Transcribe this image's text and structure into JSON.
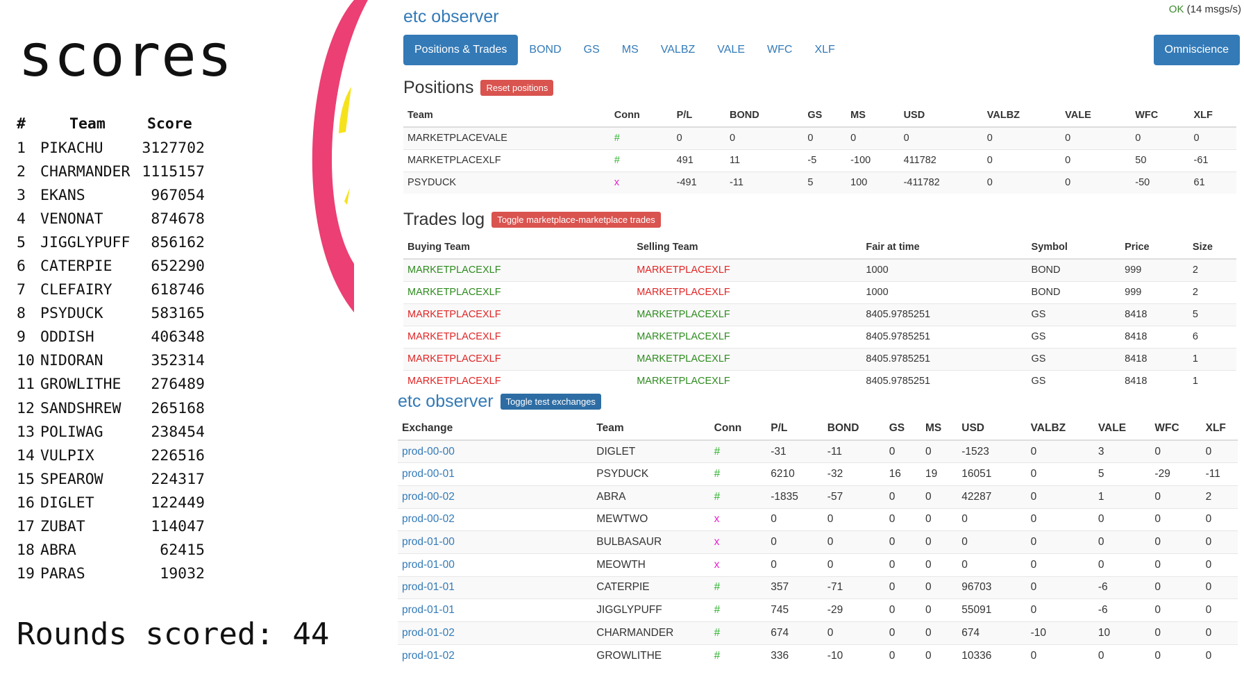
{
  "scoreboard": {
    "title": "scores",
    "headers": {
      "rank": "#",
      "team": "Team",
      "score": "Score"
    },
    "rows": [
      {
        "rank": "1",
        "team": "PIKACHU",
        "score": "3127702"
      },
      {
        "rank": "2",
        "team": "CHARMANDER",
        "score": "1115157"
      },
      {
        "rank": "3",
        "team": "EKANS",
        "score": "967054"
      },
      {
        "rank": "4",
        "team": "VENONAT",
        "score": "874678"
      },
      {
        "rank": "5",
        "team": "JIGGLYPUFF",
        "score": "856162"
      },
      {
        "rank": "6",
        "team": "CATERPIE",
        "score": "652290"
      },
      {
        "rank": "7",
        "team": "CLEFAIRY",
        "score": "618746"
      },
      {
        "rank": "8",
        "team": "PSYDUCK",
        "score": "583165"
      },
      {
        "rank": "9",
        "team": "ODDISH",
        "score": "406348"
      },
      {
        "rank": "10",
        "team": "NIDORAN",
        "score": "352314"
      },
      {
        "rank": "11",
        "team": "GROWLITHE",
        "score": "276489"
      },
      {
        "rank": "12",
        "team": "SANDSHREW",
        "score": "265168"
      },
      {
        "rank": "13",
        "team": "POLIWAG",
        "score": "238454"
      },
      {
        "rank": "14",
        "team": "VULPIX",
        "score": "226516"
      },
      {
        "rank": "15",
        "team": "SPEAROW",
        "score": "224317"
      },
      {
        "rank": "16",
        "team": "DIGLET",
        "score": "122449"
      },
      {
        "rank": "17",
        "team": "ZUBAT",
        "score": "114047"
      },
      {
        "rank": "18",
        "team": "ABRA",
        "score": "62415"
      },
      {
        "rank": "19",
        "team": "PARAS",
        "score": "19032"
      }
    ],
    "rounds_label": "Rounds scored: 44"
  },
  "observer1": {
    "brand": "etc observer",
    "status_ok": "OK",
    "status_rate": "(14 msgs/s)",
    "tabs": [
      "Positions & Trades",
      "BOND",
      "GS",
      "MS",
      "VALBZ",
      "VALE",
      "WFC",
      "XLF"
    ],
    "omniscience_label": "Omniscience",
    "positions": {
      "title": "Positions",
      "reset_label": "Reset positions",
      "headers": [
        "Team",
        "Conn",
        "P/L",
        "BOND",
        "GS",
        "MS",
        "USD",
        "VALBZ",
        "VALE",
        "WFC",
        "XLF"
      ],
      "rows": [
        {
          "team": "MARKETPLACEVALE",
          "conn": "#",
          "conn_ok": true,
          "cells": [
            "0",
            "0",
            "0",
            "0",
            "0",
            "0",
            "0",
            "0",
            "0"
          ]
        },
        {
          "team": "MARKETPLACEXLF",
          "conn": "#",
          "conn_ok": true,
          "cells": [
            "491",
            "11",
            "-5",
            "-100",
            "411782",
            "0",
            "0",
            "50",
            "-61"
          ]
        },
        {
          "team": "PSYDUCK",
          "conn": "x",
          "conn_ok": false,
          "cells": [
            "-491",
            "-11",
            "5",
            "100",
            "-411782",
            "0",
            "0",
            "-50",
            "61"
          ]
        }
      ]
    },
    "trades": {
      "title": "Trades log",
      "toggle_label": "Toggle marketplace-marketplace trades",
      "headers": [
        "Buying Team",
        "Selling Team",
        "Fair at time",
        "Symbol",
        "Price",
        "Size"
      ],
      "rows": [
        {
          "buy": "MARKETPLACEXLF",
          "buy_color": "green",
          "sell": "MARKETPLACEXLF",
          "sell_color": "red",
          "fair": "1000",
          "symbol": "BOND",
          "price": "999",
          "size": "2"
        },
        {
          "buy": "MARKETPLACEXLF",
          "buy_color": "green",
          "sell": "MARKETPLACEXLF",
          "sell_color": "red",
          "fair": "1000",
          "symbol": "BOND",
          "price": "999",
          "size": "2"
        },
        {
          "buy": "MARKETPLACEXLF",
          "buy_color": "red",
          "sell": "MARKETPLACEXLF",
          "sell_color": "green",
          "fair": "8405.9785251",
          "symbol": "GS",
          "price": "8418",
          "size": "5"
        },
        {
          "buy": "MARKETPLACEXLF",
          "buy_color": "red",
          "sell": "MARKETPLACEXLF",
          "sell_color": "green",
          "fair": "8405.9785251",
          "symbol": "GS",
          "price": "8418",
          "size": "6"
        },
        {
          "buy": "MARKETPLACEXLF",
          "buy_color": "red",
          "sell": "MARKETPLACEXLF",
          "sell_color": "green",
          "fair": "8405.9785251",
          "symbol": "GS",
          "price": "8418",
          "size": "1"
        },
        {
          "buy": "MARKETPLACEXLF",
          "buy_color": "red",
          "sell": "MARKETPLACEXLF",
          "sell_color": "green",
          "fair": "8405.9785251",
          "symbol": "GS",
          "price": "8418",
          "size": "1"
        }
      ]
    }
  },
  "observer2": {
    "brand": "etc observer",
    "toggle_label": "Toggle test exchanges",
    "headers": [
      "Exchange",
      "Team",
      "Conn",
      "P/L",
      "BOND",
      "GS",
      "MS",
      "USD",
      "VALBZ",
      "VALE",
      "WFC",
      "XLF"
    ],
    "rows": [
      {
        "exchange": "prod-00-00",
        "team": "DIGLET",
        "conn": "#",
        "conn_ok": true,
        "cells": [
          "-31",
          "-11",
          "0",
          "0",
          "-1523",
          "0",
          "3",
          "0",
          "0"
        ]
      },
      {
        "exchange": "prod-00-01",
        "team": "PSYDUCK",
        "conn": "#",
        "conn_ok": true,
        "cells": [
          "6210",
          "-32",
          "16",
          "19",
          "16051",
          "0",
          "5",
          "-29",
          "-11"
        ]
      },
      {
        "exchange": "prod-00-02",
        "team": "ABRA",
        "conn": "#",
        "conn_ok": true,
        "cells": [
          "-1835",
          "-57",
          "0",
          "0",
          "42287",
          "0",
          "1",
          "0",
          "2"
        ]
      },
      {
        "exchange": "prod-00-02",
        "team": "MEWTWO",
        "conn": "x",
        "conn_ok": false,
        "cells": [
          "0",
          "0",
          "0",
          "0",
          "0",
          "0",
          "0",
          "0",
          "0"
        ]
      },
      {
        "exchange": "prod-01-00",
        "team": "BULBASAUR",
        "conn": "x",
        "conn_ok": false,
        "cells": [
          "0",
          "0",
          "0",
          "0",
          "0",
          "0",
          "0",
          "0",
          "0"
        ]
      },
      {
        "exchange": "prod-01-00",
        "team": "MEOWTH",
        "conn": "x",
        "conn_ok": false,
        "cells": [
          "0",
          "0",
          "0",
          "0",
          "0",
          "0",
          "0",
          "0",
          "0"
        ]
      },
      {
        "exchange": "prod-01-01",
        "team": "CATERPIE",
        "conn": "#",
        "conn_ok": true,
        "cells": [
          "357",
          "-71",
          "0",
          "0",
          "96703",
          "0",
          "-6",
          "0",
          "0"
        ]
      },
      {
        "exchange": "prod-01-01",
        "team": "JIGGLYPUFF",
        "conn": "#",
        "conn_ok": true,
        "cells": [
          "745",
          "-29",
          "0",
          "0",
          "55091",
          "0",
          "-6",
          "0",
          "0"
        ]
      },
      {
        "exchange": "prod-01-02",
        "team": "CHARMANDER",
        "conn": "#",
        "conn_ok": true,
        "cells": [
          "674",
          "0",
          "0",
          "0",
          "674",
          "-10",
          "10",
          "0",
          "0"
        ]
      },
      {
        "exchange": "prod-01-02",
        "team": "GROWLITHE",
        "conn": "#",
        "conn_ok": true,
        "cells": [
          "336",
          "-10",
          "0",
          "0",
          "10336",
          "0",
          "0",
          "0",
          "0"
        ]
      }
    ]
  },
  "colors": {
    "accent": "#337ab7",
    "danger": "#d9534f",
    "decor_pink": "#ec3f73",
    "decor_yellow": "#f6e21a",
    "conn_ok": "#2fb32f",
    "conn_bad": "#e81ccf"
  }
}
